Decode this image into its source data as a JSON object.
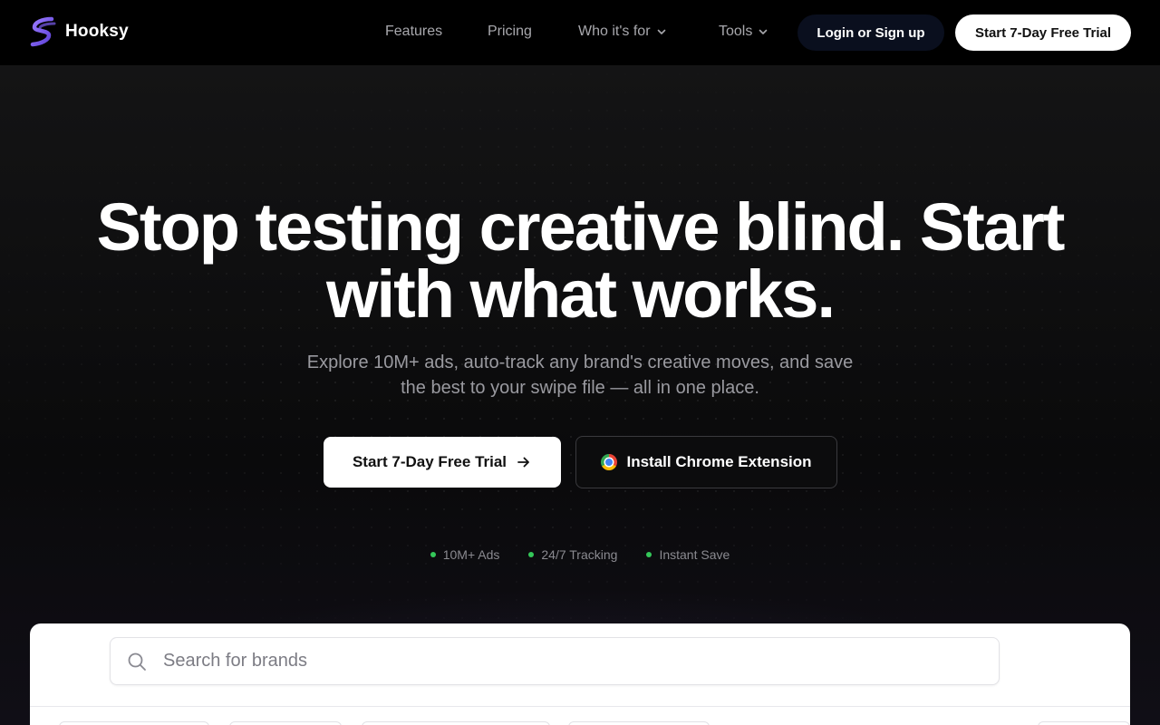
{
  "nav": {
    "brand": "Hooksy",
    "links": [
      {
        "label": "Features"
      },
      {
        "label": "Pricing"
      },
      {
        "label": "Who it's for",
        "dropdown": true
      },
      {
        "label": "Tools",
        "dropdown": true
      }
    ],
    "login_label": "Login or Sign up",
    "trial_label": "Start 7-Day Free Trial"
  },
  "hero": {
    "headline_line1": "Stop testing creative blind. Start",
    "headline_line2": "with what works.",
    "subtitle_line1": "Explore 10M+ ads, auto-track any brand's creative moves, and save",
    "subtitle_line2": "the best to your swipe file — all in one place.",
    "cta_primary": "Start 7-Day Free Trial",
    "cta_secondary": "Install Chrome Extension",
    "features": [
      "10M+ Ads",
      "24/7 Tracking",
      "Instant Save"
    ]
  },
  "preview": {
    "search_placeholder": "Search for brands"
  },
  "colors": {
    "brand_accent": "#7b5cf0",
    "feature_dot": "#34c759",
    "nav_background": "#000000"
  },
  "icons": {
    "logo": "hooksy-logo-icon",
    "chevron": "chevron-down-icon",
    "arrow": "arrow-right-icon",
    "chrome": "chrome-icon",
    "search": "search-icon"
  }
}
